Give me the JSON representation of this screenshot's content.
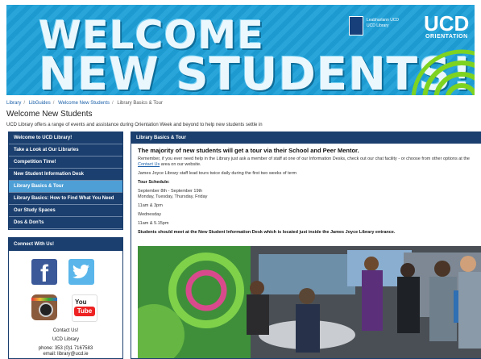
{
  "banner": {
    "line1": "WELCOME",
    "line2": "NEW STUDENTS!",
    "logo_text": "Leabharlann UCD\nUCD Library",
    "ucd": "UCD",
    "orientation": "ORIENTATION",
    "colors": {
      "background": "#1ea0d8",
      "rings": "#7ed321"
    }
  },
  "breadcrumb": [
    "Library",
    "LibGuides",
    "Welcome New Students",
    "Library Basics & Tour"
  ],
  "page_title": "Welcome New Students",
  "intro": "UCD Library offers a range of events and assistance during Orientation Week and beyond to help new students settle in",
  "nav": {
    "items": [
      {
        "label": "Welcome to UCD Library!",
        "active": false
      },
      {
        "label": "Take a Look at Our Libraries",
        "active": false
      },
      {
        "label": "Competition Time!",
        "active": false
      },
      {
        "label": "New Student Information Desk",
        "active": false
      },
      {
        "label": "Library Basics & Tour",
        "active": true
      },
      {
        "label": "Library Basics: How to Find What You Need",
        "active": false
      },
      {
        "label": "Our Study Spaces",
        "active": false
      },
      {
        "label": "Dos & Don'ts",
        "active": false
      }
    ]
  },
  "connect": {
    "title": "Connect With Us!",
    "icons": [
      "facebook-icon",
      "twitter-icon",
      "instagram-icon",
      "youtube-icon"
    ],
    "youtube_you": "You",
    "youtube_tube": "Tube",
    "facebook_glyph": "f",
    "line1": "Contact Us!",
    "line2": "UCD Library",
    "phone": "phone: 353 (0)1 7167583",
    "email": "email: library@ucd.ie"
  },
  "main": {
    "title": "Library Basics & Tour",
    "lead": "The majority of new students will get a tour via their School and Peer Mentor.",
    "p1_before": "Remember, if you ever need help in the Library just ask a member of staff at one of our Information Desks, check out our chat facility - or choose from other options at the ",
    "p1_link": "Contact Us",
    "p1_after": " area on our website.",
    "p2": "James Joyce Library staff lead tours twice daily during the first two weeks of term",
    "schedule_label": "Tour Schedule:",
    "dates": "September 8th - September 19th",
    "days": "Monday, Tuesday, Thursday, Friday",
    "times1": "11am & 3pm",
    "day2": "Wednesday",
    "times2": "11am & 5.15pm",
    "closing": "Students should meet at the New Student Information Desk which is located just inside the James Joyce Library entrance."
  }
}
